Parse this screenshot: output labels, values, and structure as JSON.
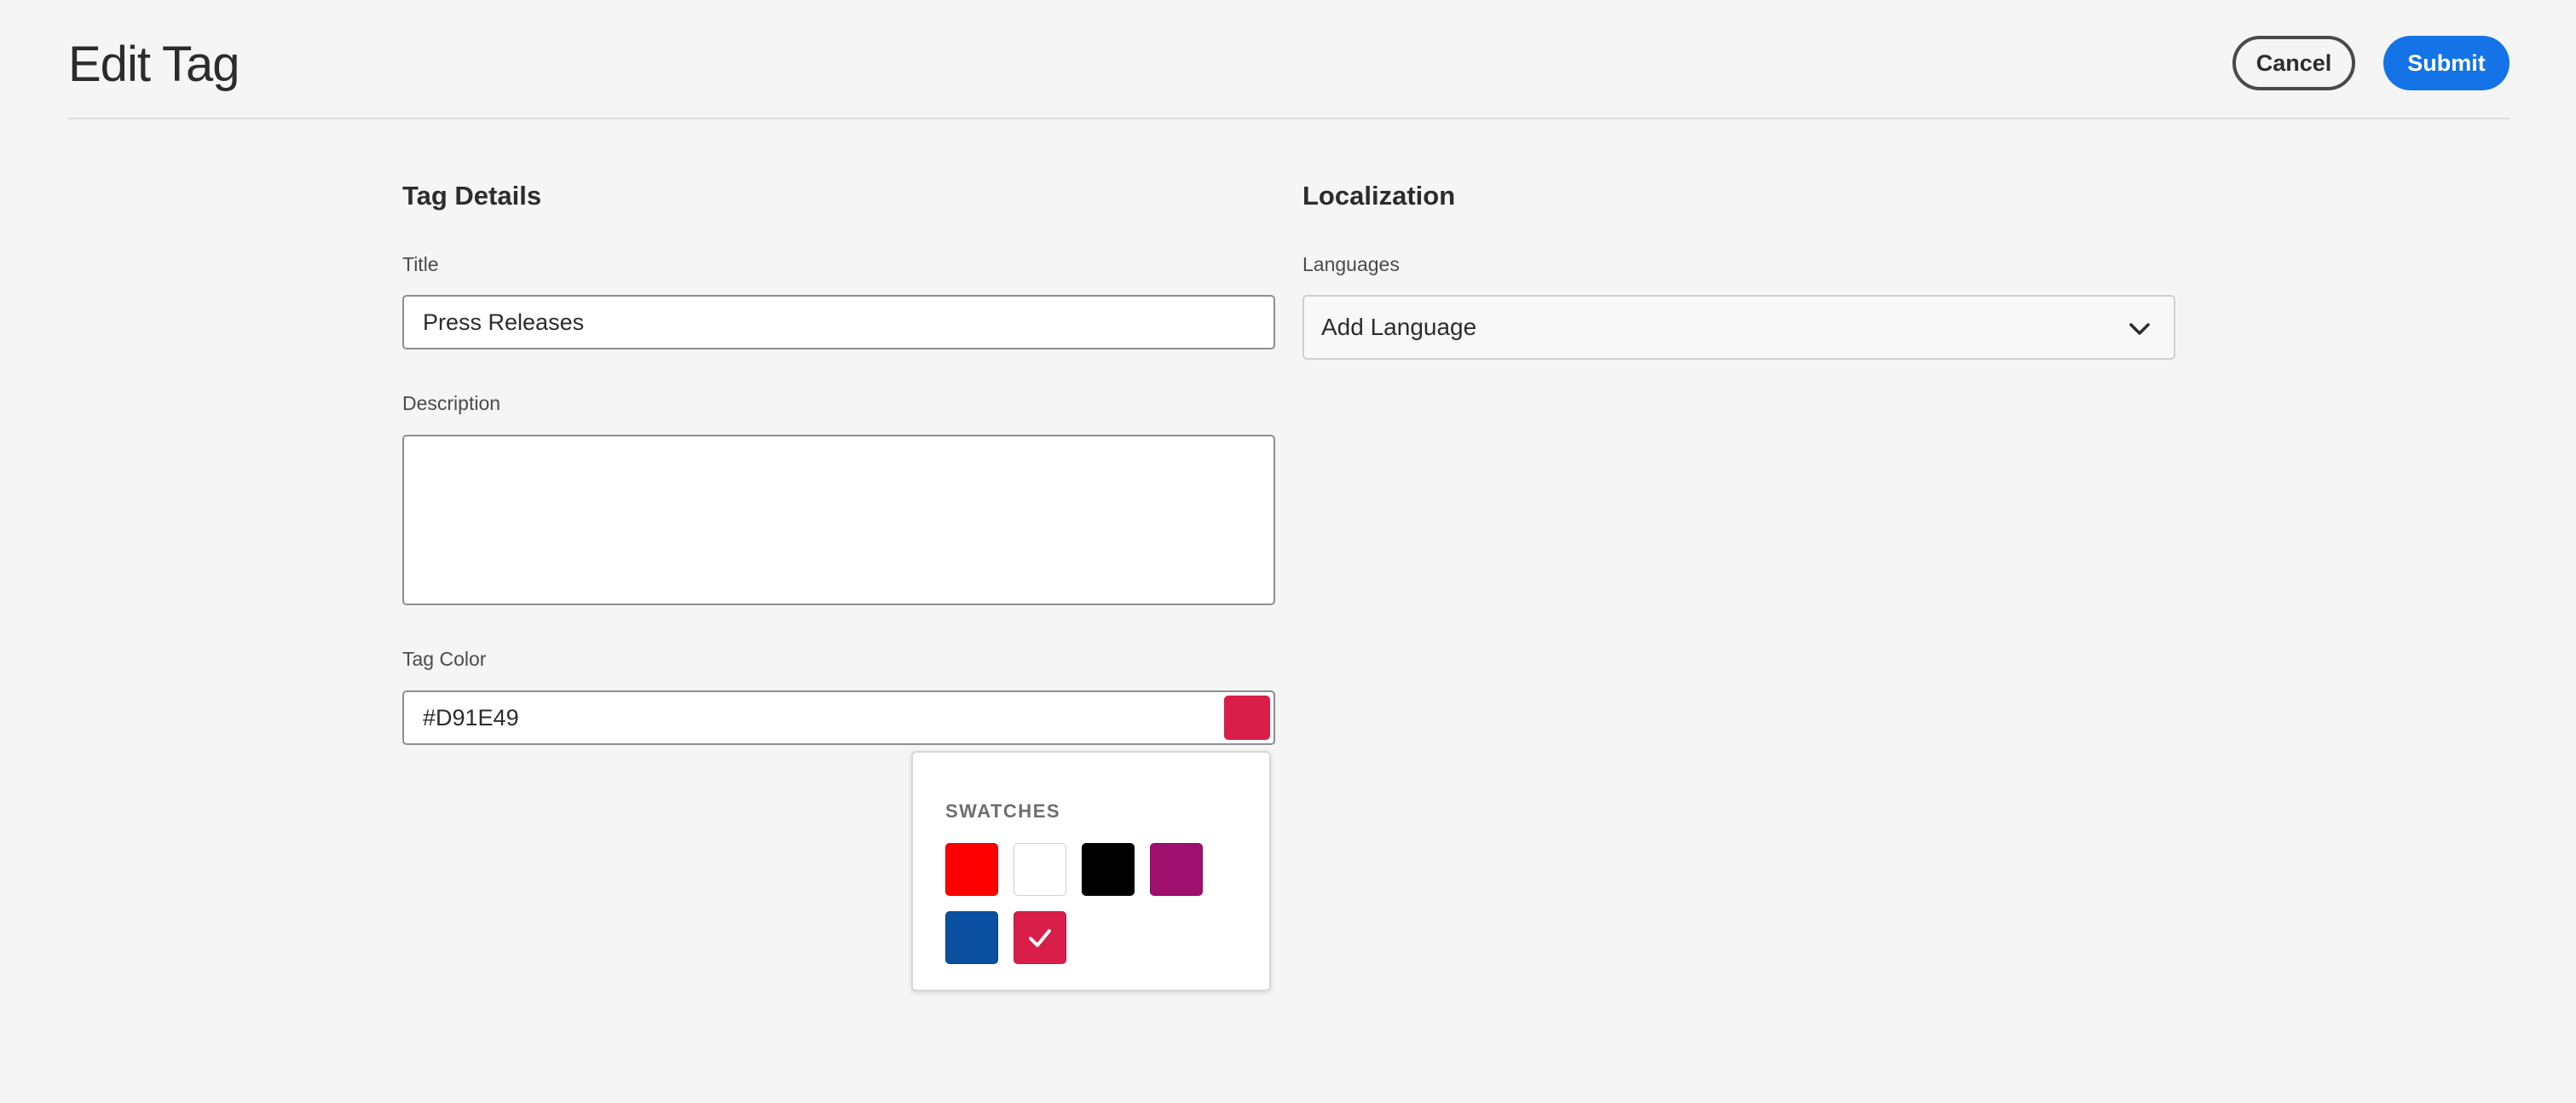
{
  "header": {
    "title": "Edit Tag",
    "cancel_label": "Cancel",
    "submit_label": "Submit"
  },
  "tag_details": {
    "section_title": "Tag Details",
    "title_label": "Title",
    "title_value": "Press Releases",
    "description_label": "Description",
    "description_value": "",
    "color_label": "Tag Color",
    "color_value": "#D91E49"
  },
  "localization": {
    "section_title": "Localization",
    "languages_label": "Languages",
    "languages_value": "Add Language",
    "dropdown_icon": "chevron-down-icon"
  },
  "swatches": {
    "heading": "SWATCHES",
    "items": [
      {
        "color": "#FF0000",
        "selected": false
      },
      {
        "color": "#FFFFFF",
        "selected": false
      },
      {
        "color": "#000000",
        "selected": false
      },
      {
        "color": "#9E0F6E",
        "selected": false
      },
      {
        "color": "#0A4FA0",
        "selected": false
      },
      {
        "color": "#D91E49",
        "selected": true
      }
    ],
    "selected_icon": "checkmark-icon"
  },
  "colors": {
    "accent": "#1473E6",
    "page_background": "#F5F5F5"
  }
}
